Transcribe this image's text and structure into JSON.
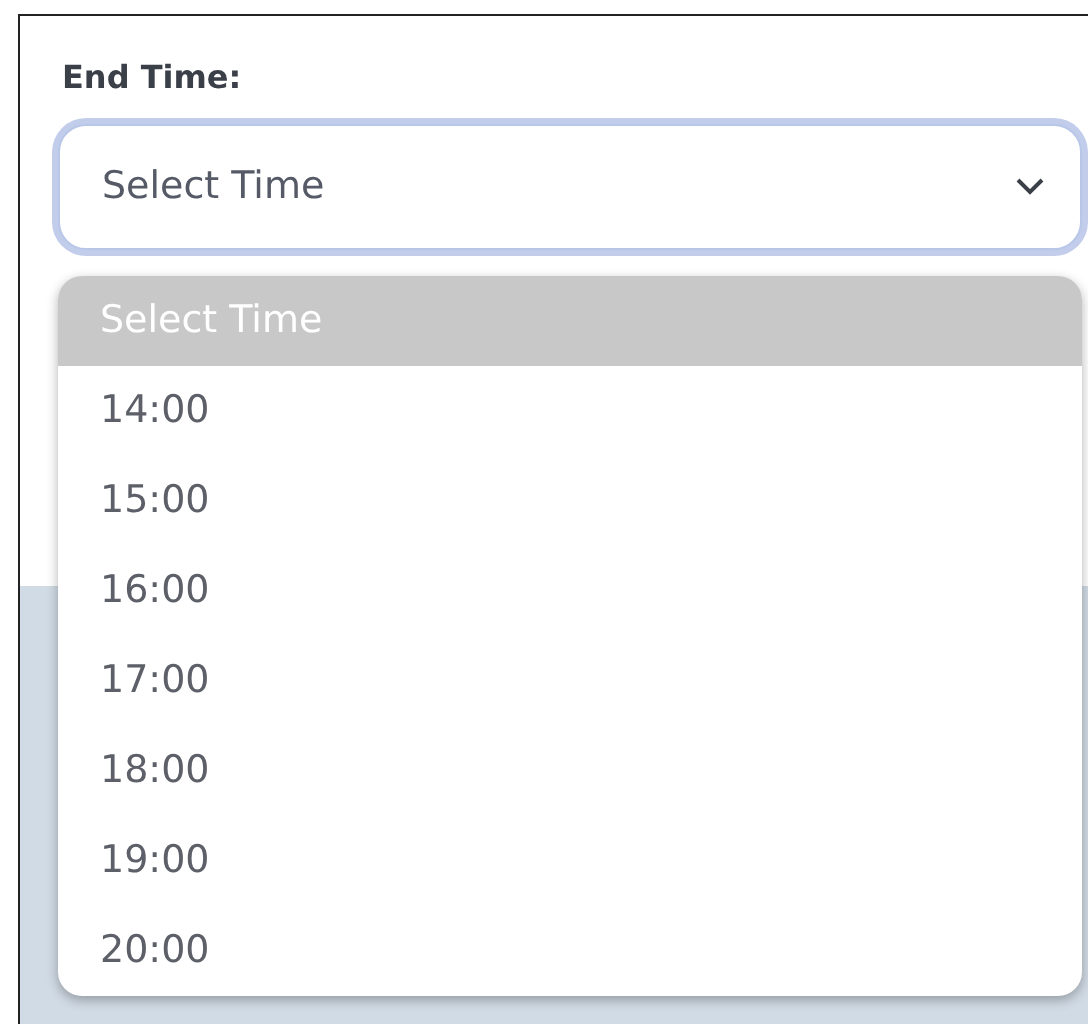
{
  "field": {
    "label": "End Time:",
    "value": "Select Time",
    "focused": true
  },
  "dropdown": {
    "options": [
      {
        "label": "Select Time",
        "selected": true
      },
      {
        "label": "14:00",
        "selected": false
      },
      {
        "label": "15:00",
        "selected": false
      },
      {
        "label": "16:00",
        "selected": false
      },
      {
        "label": "17:00",
        "selected": false
      },
      {
        "label": "18:00",
        "selected": false
      },
      {
        "label": "19:00",
        "selected": false
      },
      {
        "label": "20:00",
        "selected": false
      }
    ]
  }
}
